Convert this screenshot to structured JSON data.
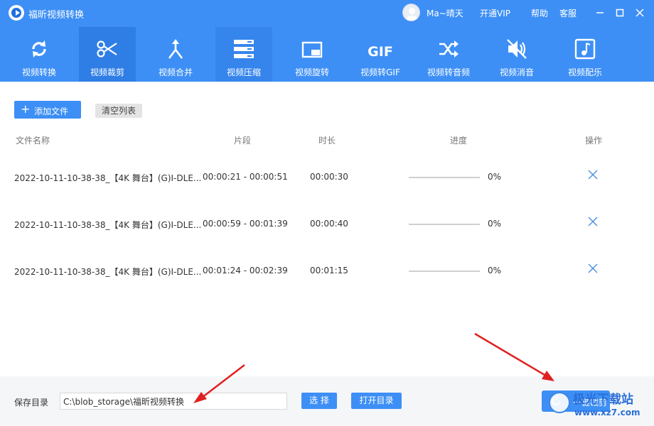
{
  "app": {
    "title": "福昕视频转换"
  },
  "user": {
    "name": "Ma~晴天"
  },
  "topbar": {
    "vip": "开通VIP",
    "help": "帮助",
    "service": "客服"
  },
  "toolbar": [
    {
      "label": "视频转换",
      "icon": "convert-icon"
    },
    {
      "label": "视频裁剪",
      "icon": "scissors-icon"
    },
    {
      "label": "视频合并",
      "icon": "merge-icon"
    },
    {
      "label": "视频压缩",
      "icon": "compress-icon"
    },
    {
      "label": "视频旋转",
      "icon": "rotate-icon"
    },
    {
      "label": "视频转GIF",
      "icon": "gif-icon",
      "icon_text": "GIF"
    },
    {
      "label": "视频转音频",
      "icon": "shuffle-icon"
    },
    {
      "label": "视频消音",
      "icon": "mute-icon"
    },
    {
      "label": "视频配乐",
      "icon": "music-icon"
    }
  ],
  "actions": {
    "add": "添加文件",
    "clear": "清空列表"
  },
  "columns": {
    "name": "文件名称",
    "segment": "片段",
    "duration": "时长",
    "progress": "进度",
    "action": "操作"
  },
  "files": [
    {
      "name": "2022-10-11-10-38-38_【4K 舞台】(G)I-DLE...",
      "segment": "00:00:21 - 00:00:51",
      "duration": "00:00:30",
      "progress": "0%"
    },
    {
      "name": "2022-10-11-10-38-38_【4K 舞台】(G)I-DLE...",
      "segment": "00:00:59 - 00:01:39",
      "duration": "00:00:40",
      "progress": "0%"
    },
    {
      "name": "2022-10-11-10-38-38_【4K 舞台】(G)I-DLE...",
      "segment": "00:01:24 - 00:02:39",
      "duration": "00:01:15",
      "progress": "0%"
    }
  ],
  "footer": {
    "save_label": "保存目录",
    "save_path": "C:\\blob_storage\\福昕视频转换",
    "choose": "选 择",
    "open_dir": "打开目录",
    "start": "一键裁剪"
  },
  "watermark": {
    "line1": "极光下载站",
    "line2": "www.xz7.com"
  },
  "colors": {
    "accent": "#3d8ff5",
    "header": "#3d8ff5",
    "active_tab": "#2f7ee6",
    "arrow": "#e02020"
  }
}
